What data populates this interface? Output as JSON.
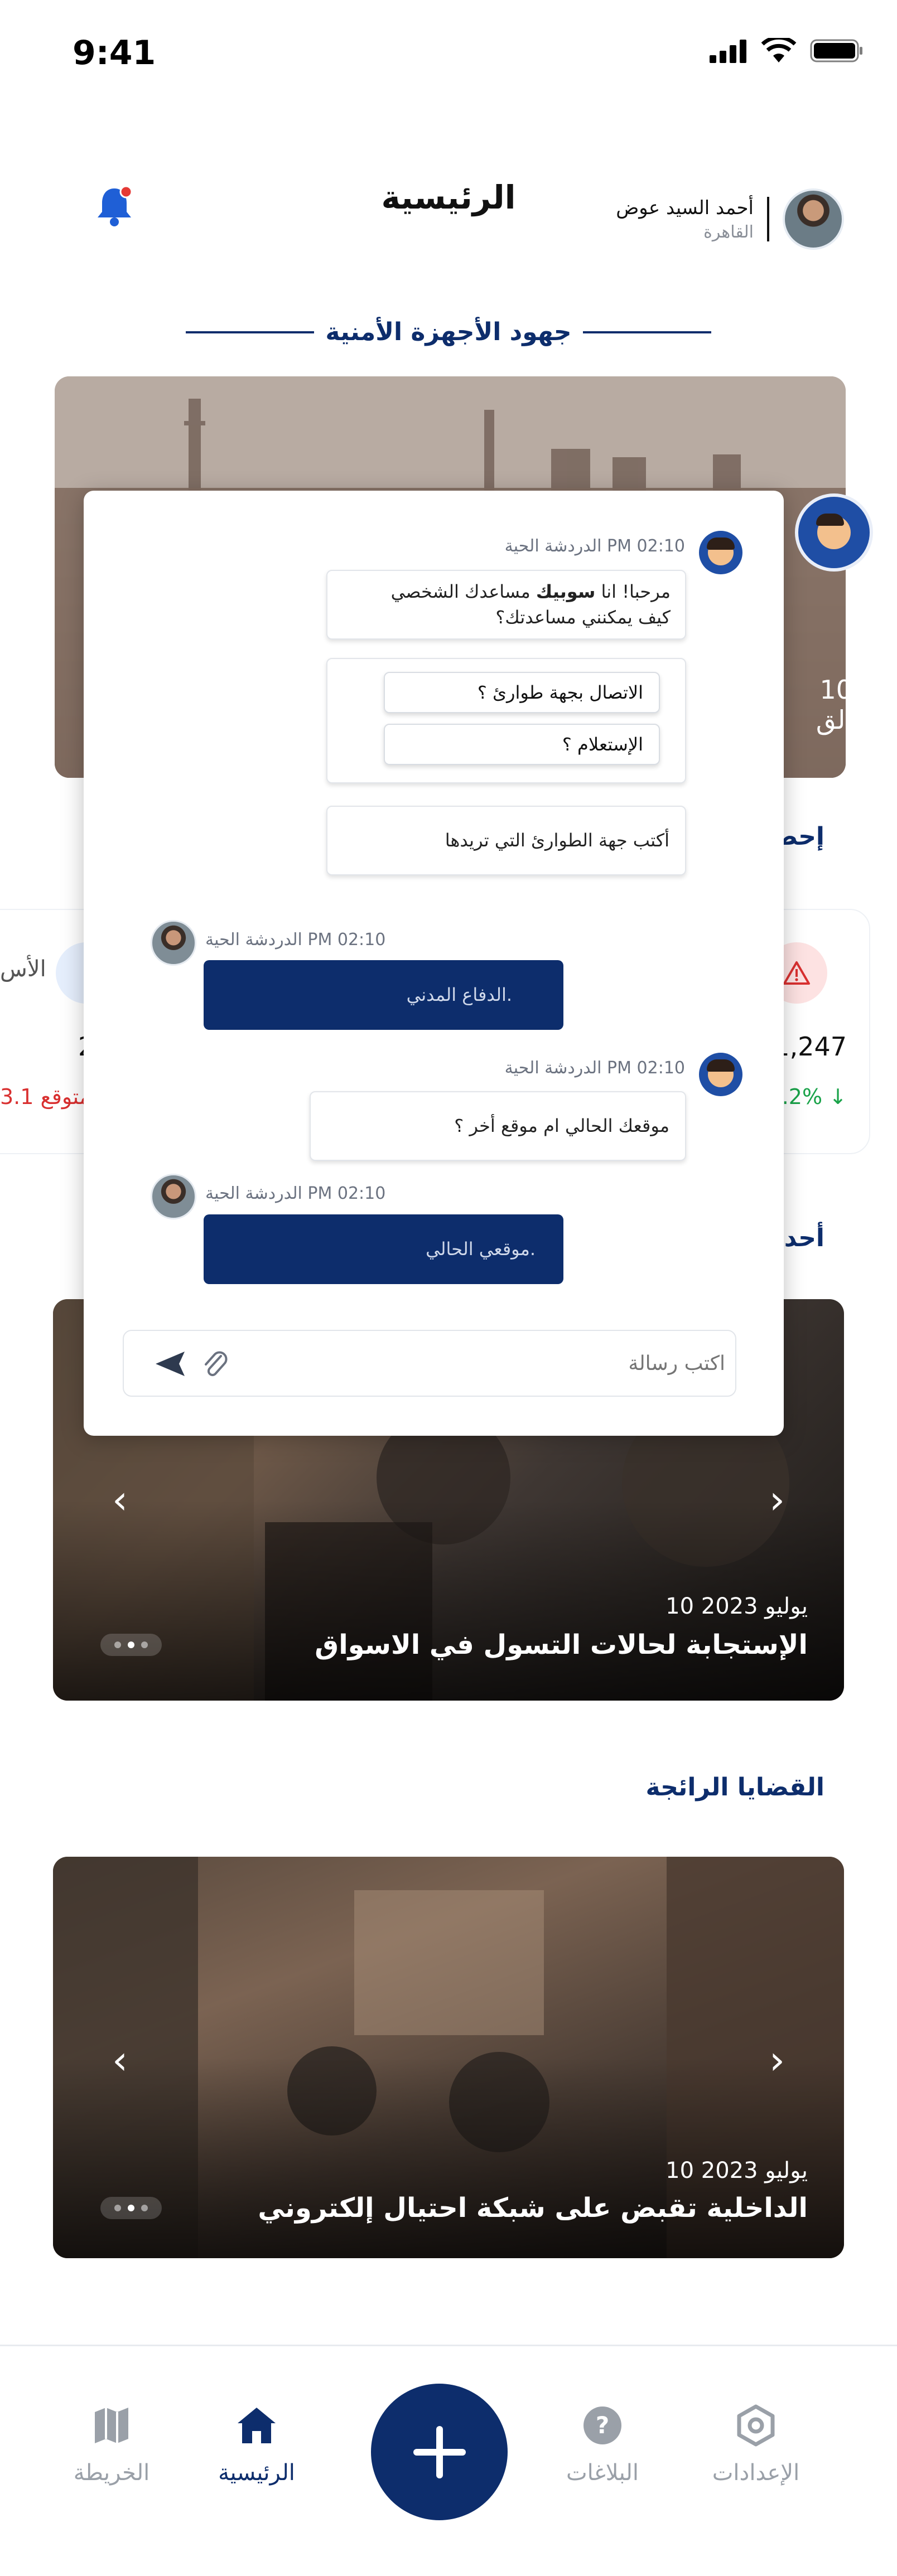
{
  "status_bar": {
    "time": "9:41"
  },
  "header": {
    "title": "الرئيسية",
    "user_name": "أحمد السيد عوض",
    "user_city": "القاهرة"
  },
  "sections": {
    "security_efforts": "جهود الأجهزة الأمنية",
    "stats_partial": "إحص",
    "news_partial": "أحد",
    "trending": "القضايا الرائجة"
  },
  "hero": {
    "peek_number": "10",
    "peek_text": "الق"
  },
  "stats": {
    "right_value": "1,247",
    "right_change": "8.2% ↓",
    "left_label_partial": "الأس",
    "left_value_partial": "2",
    "left_change_partial": "3.1 متوقع"
  },
  "cards": [
    {
      "date": "10 يوليو 2023",
      "title": "الإستجابة لحالات التسول في الاسواق"
    },
    {
      "date": "10 يوليو 2023",
      "title": "الداخلية تقبض على شبكة احتيال إلكتروني"
    }
  ],
  "chat": {
    "messages": [
      {
        "from": "bot",
        "meta": "الدردشة الحية PM 02:10",
        "text_prefix": "مرحبا! انا ",
        "bot_name": "سوبيك",
        "text_suffix": " مساعدك الشخصي",
        "text_line2": "كيف يمكنني مساعدتك؟"
      },
      {
        "from": "bot",
        "type": "options",
        "options": [
          "الاتصال بجهة طوارئ ؟",
          "الإستعلام ؟"
        ]
      },
      {
        "from": "bot",
        "text": "أكتب جهة الطوارئ التي تريدها"
      },
      {
        "from": "user",
        "meta": "الدردشة الحية PM 02:10",
        "text": "الدفاع المدني."
      },
      {
        "from": "bot",
        "meta": "الدردشة الحية PM 02:10",
        "text": "موقعك الحالي ام موقع أخر ؟"
      },
      {
        "from": "user",
        "meta": "الدردشة الحية PM 02:10",
        "text": "موقعي الحالي."
      }
    ],
    "input_placeholder": "اكتب رسالة"
  },
  "tabbar": {
    "items": [
      {
        "label": "الخريطة",
        "icon": "map-icon"
      },
      {
        "label": "الرئيسية",
        "icon": "home-icon",
        "active": true
      },
      {
        "label": "",
        "icon": "plus-icon"
      },
      {
        "label": "البلاغات",
        "icon": "question-icon"
      },
      {
        "label": "الإعدادات",
        "icon": "settings-icon"
      }
    ]
  },
  "colors": {
    "primary": "#0d2d6c",
    "bell": "#1f5fd6",
    "alert_red": "#d93030",
    "positive_green": "#1aa34a"
  }
}
